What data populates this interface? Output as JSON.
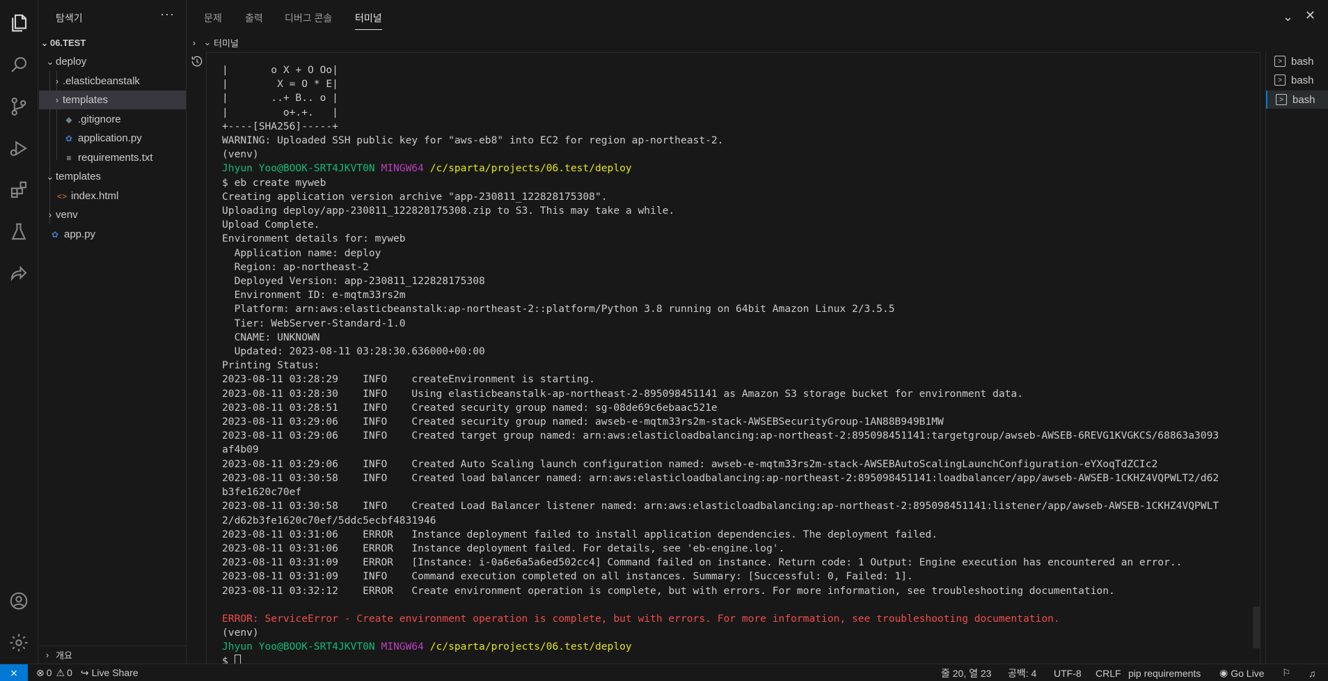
{
  "sidebar": {
    "title": "탐색기",
    "more": "···",
    "root": "06.TEST",
    "items": [
      {
        "label": "deploy"
      },
      {
        "label": ".elasticbeanstalk"
      },
      {
        "label": "templates"
      },
      {
        "label": ".gitignore"
      },
      {
        "label": "application.py"
      },
      {
        "label": "requirements.txt"
      },
      {
        "label": "templates"
      },
      {
        "label": "index.html"
      },
      {
        "label": "venv"
      },
      {
        "label": "app.py"
      }
    ],
    "outline": "개요"
  },
  "panel": {
    "tabs": [
      {
        "label": "문제"
      },
      {
        "label": "출력"
      },
      {
        "label": "디버그 콘솔"
      },
      {
        "label": "터미널"
      }
    ],
    "subhead": "터미널"
  },
  "terminal": {
    "lines": [
      "|       o X + O Oo|",
      "|        X = O * E|",
      "|       ..+ B.. o |",
      "|         o+.+.   |",
      "+----[SHA256]-----+",
      "WARNING: Uploaded SSH public key for \"aws-eb8\" into EC2 for region ap-northeast-2.",
      "(venv)",
      "",
      "$ eb create myweb",
      "Creating application version archive \"app-230811_122828175308\".",
      "Uploading deploy/app-230811_122828175308.zip to S3. This may take a while.",
      "Upload Complete.",
      "Environment details for: myweb",
      "  Application name: deploy",
      "  Region: ap-northeast-2",
      "  Deployed Version: app-230811_122828175308",
      "  Environment ID: e-mqtm33rs2m",
      "  Platform: arn:aws:elasticbeanstalk:ap-northeast-2::platform/Python 3.8 running on 64bit Amazon Linux 2/3.5.5",
      "  Tier: WebServer-Standard-1.0",
      "  CNAME: UNKNOWN",
      "  Updated: 2023-08-11 03:28:30.636000+00:00",
      "Printing Status:",
      "2023-08-11 03:28:29    INFO    createEnvironment is starting.",
      "2023-08-11 03:28:30    INFO    Using elasticbeanstalk-ap-northeast-2-895098451141 as Amazon S3 storage bucket for environment data.",
      "2023-08-11 03:28:51    INFO    Created security group named: sg-08de69c6ebaac521e",
      "2023-08-11 03:29:06    INFO    Created security group named: awseb-e-mqtm33rs2m-stack-AWSEBSecurityGroup-1AN88B949B1MW",
      "2023-08-11 03:29:06    INFO    Created target group named: arn:aws:elasticloadbalancing:ap-northeast-2:895098451141:targetgroup/awseb-AWSEB-6REVG1KVGKCS/68863a3093",
      "af4b09",
      "2023-08-11 03:29:06    INFO    Created Auto Scaling launch configuration named: awseb-e-mqtm33rs2m-stack-AWSEBAutoScalingLaunchConfiguration-eYXoqTdZCIc2",
      "2023-08-11 03:30:58    INFO    Created load balancer named: arn:aws:elasticloadbalancing:ap-northeast-2:895098451141:loadbalancer/app/awseb-AWSEB-1CKHZ4VQPWLT2/d62",
      "b3fe1620c70ef",
      "2023-08-11 03:30:58    INFO    Created Load Balancer listener named: arn:aws:elasticloadbalancing:ap-northeast-2:895098451141:listener/app/awseb-AWSEB-1CKHZ4VQPWLT",
      "2/d62b3fe1620c70ef/5ddc5ecbf4831946",
      "2023-08-11 03:31:06    ERROR   Instance deployment failed to install application dependencies. The deployment failed.",
      "2023-08-11 03:31:06    ERROR   Instance deployment failed. For details, see 'eb-engine.log'.",
      "2023-08-11 03:31:09    ERROR   [Instance: i-0a6e6a5a6ed502cc4] Command failed on instance. Return code: 1 Output: Engine execution has encountered an error..",
      "2023-08-11 03:31:09    INFO    Command execution completed on all instances. Summary: [Successful: 0, Failed: 1].",
      "2023-08-11 03:32:12    ERROR   Create environment operation is complete, but with errors. For more information, see troubleshooting documentation.",
      ""
    ],
    "prompt_user": "Jhyun Yoo@BOOK-SRT4JKVT0N",
    "prompt_env": "MINGW64",
    "prompt_path": "/c/sparta/projects/06.test/deploy",
    "error_line": "ERROR: ServiceError - Create environment operation is complete, but with errors. For more information, see troubleshooting documentation.",
    "venv": "(venv)",
    "prompt_symbol": "$"
  },
  "terminal_list": [
    {
      "label": "bash"
    },
    {
      "label": "bash"
    },
    {
      "label": "bash"
    }
  ],
  "statusbar": {
    "errors": "0",
    "warnings": "0",
    "live_share": "Live Share",
    "position": "줄 20, 열 23",
    "spaces": "공백: 4",
    "encoding": "UTF-8",
    "eol": "CRLF",
    "language": "pip requirements",
    "go_live": "Go Live"
  },
  "colors": {
    "accent": "#0078d4",
    "prompt_green": "#0dbc79",
    "prompt_purple": "#bc3fbc",
    "prompt_yellow": "#e5e510",
    "error_red": "#f14c4c"
  }
}
